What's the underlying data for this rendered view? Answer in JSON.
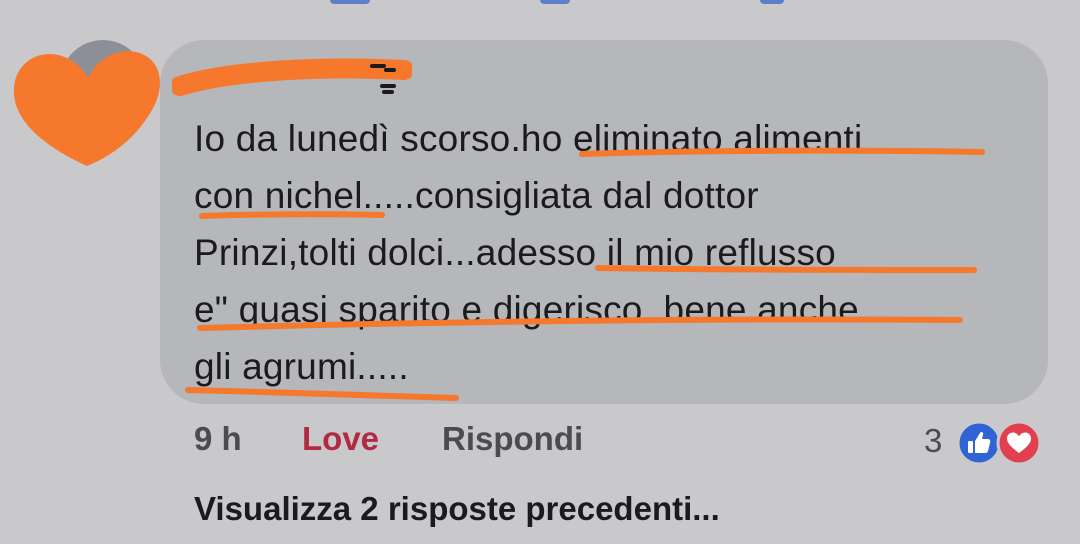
{
  "comment": {
    "lines": [
      "Io da lunedì scorso.ho eliminato alimenti",
      "con nichel.....consigliata dal dottor",
      "Prinzi,tolti  dolci...adesso il mio reflusso",
      "e\" quasi sparito e digerisco..bene anche",
      "gli agrumi....."
    ],
    "time": "9 h",
    "love_label": "Love",
    "reply_label": "Rispondi",
    "reaction_count": "3",
    "reaction_icons": [
      "like-icon",
      "love-icon"
    ]
  },
  "replies": {
    "view_previous_label": "Visualizza 2 risposte precedenti..."
  },
  "colors": {
    "background": "#c9c9cc",
    "bubble": "#b6b7bb",
    "redaction_orange": "#f5782d",
    "like_blue": "#2f63d6",
    "love_red": "#e0404f",
    "love_text": "#b02a44"
  }
}
